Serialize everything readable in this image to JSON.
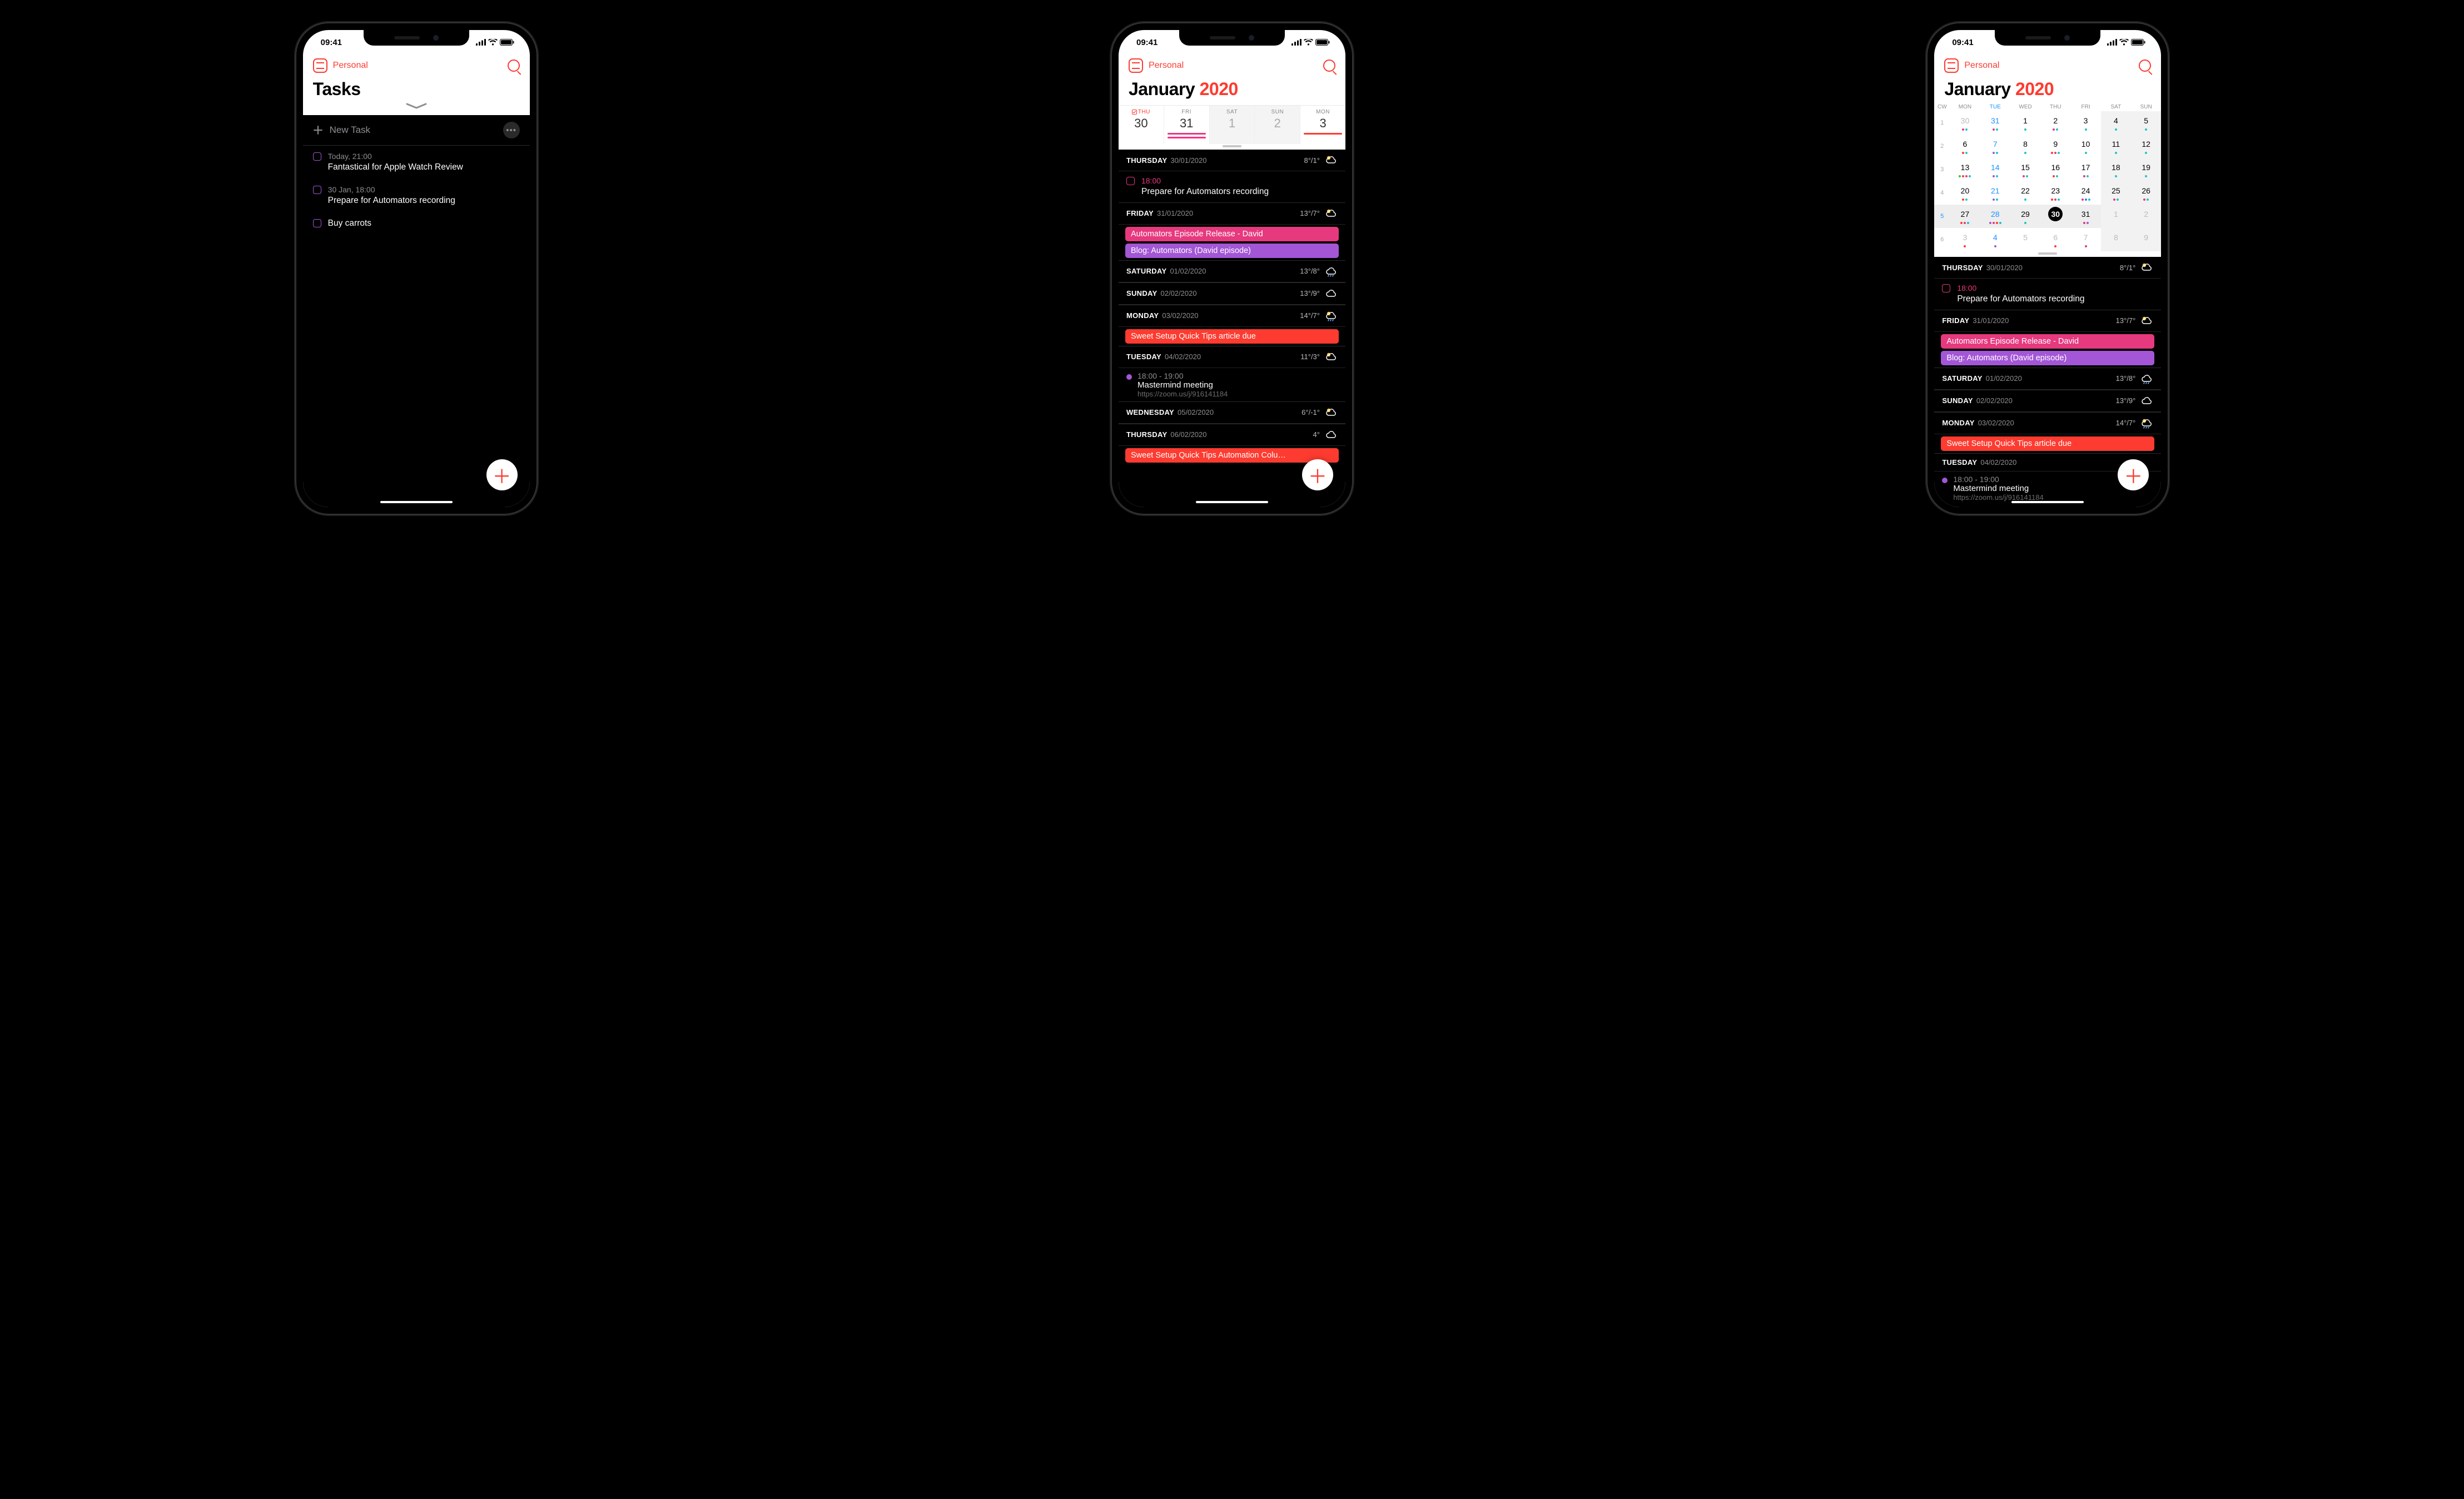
{
  "status": {
    "time": "09:41"
  },
  "header": {
    "calendar_set": "Personal"
  },
  "colors": {
    "accent": "#fd3b30",
    "pink": "#e6397e",
    "magenta": "#ff2d87",
    "purple": "#a356d6",
    "red": "#fd3b30",
    "green": "#2fc24b",
    "blue": "#2f7fff"
  },
  "phone1": {
    "title": "Tasks",
    "new_task_label": "New Task",
    "tasks": [
      {
        "time": "Today, 21:00",
        "title": "Fantastical for Apple Watch Review",
        "color": "purple"
      },
      {
        "time": "30 Jan, 18:00",
        "title": "Prepare for Automators recording",
        "color": "purple"
      },
      {
        "time": "",
        "title": "Buy carrots",
        "color": "purple"
      }
    ]
  },
  "phone2": {
    "title_month": "January",
    "title_year": "2020",
    "week": [
      {
        "label": "THU",
        "num": "30",
        "selected": true,
        "has_task": true
      },
      {
        "label": "FRI",
        "num": "31",
        "bars": [
          "#e6397e",
          "#ff2d87"
        ]
      },
      {
        "label": "SAT",
        "num": "1",
        "gray": true,
        "shade": true
      },
      {
        "label": "SUN",
        "num": "2",
        "gray": true,
        "shade": true
      },
      {
        "label": "MON",
        "num": "3",
        "bars": [
          "#fd3b30"
        ]
      }
    ],
    "agenda": [
      {
        "dow": "THURSDAY",
        "date": "30/01/2020",
        "hi": "8°",
        "lo": "1°",
        "wicon": "sun-cloud",
        "items": [
          {
            "type": "task",
            "time": "18:00",
            "title": "Prepare for Automators recording",
            "color": "pink"
          }
        ]
      },
      {
        "dow": "FRIDAY",
        "date": "31/01/2020",
        "hi": "13°",
        "lo": "7°",
        "wicon": "sun-cloud",
        "items": [
          {
            "type": "pill",
            "title": "Automators Episode Release - David",
            "bg": "#e6397e"
          },
          {
            "type": "pill",
            "title": "Blog: Automators (David episode)",
            "bg": "#a356d6"
          }
        ]
      },
      {
        "dow": "SATURDAY",
        "date": "01/02/2020",
        "hi": "13°",
        "lo": "8°",
        "wicon": "rain",
        "items": []
      },
      {
        "dow": "SUNDAY",
        "date": "02/02/2020",
        "hi": "13°",
        "lo": "9°",
        "wicon": "cloud",
        "items": []
      },
      {
        "dow": "MONDAY",
        "date": "03/02/2020",
        "hi": "14°",
        "lo": "7°",
        "wicon": "sun-rain",
        "items": [
          {
            "type": "pill",
            "title": "Sweet Setup Quick Tips article due",
            "bg": "#fd3b30"
          }
        ]
      },
      {
        "dow": "TUESDAY",
        "date": "04/02/2020",
        "hi": "11°",
        "lo": "3°",
        "wicon": "sun-cloud",
        "items": [
          {
            "type": "event",
            "time": "18:00 - 19:00",
            "title": "Mastermind meeting",
            "link": "https://zoom.us/j/916141184",
            "dot": "#a356d6"
          }
        ]
      },
      {
        "dow": "WEDNESDAY",
        "date": "05/02/2020",
        "hi": "6°",
        "lo": "-1°",
        "wicon": "sun-cloud",
        "items": []
      },
      {
        "dow": "THURSDAY",
        "date": "06/02/2020",
        "hi": "4°",
        "lo": "",
        "wicon": "cloud",
        "items": [
          {
            "type": "pill",
            "title": "Sweet Setup Quick Tips Automation Colu…",
            "bg": "#fd3b30"
          }
        ]
      }
    ]
  },
  "phone3": {
    "title_month": "January",
    "title_year": "2020",
    "month_header": [
      "CW",
      "MON",
      "TUE",
      "WED",
      "THU",
      "FRI",
      "SAT",
      "SUN"
    ],
    "weeks": [
      {
        "cw": "1",
        "days": [
          {
            "n": "30",
            "gray": true,
            "dots": [
              "pink",
              "teal"
            ]
          },
          {
            "n": "31",
            "gray": true,
            "tue": true,
            "dots": [
              "pink",
              "teal"
            ]
          },
          {
            "n": "1",
            "dots": [
              "teal"
            ]
          },
          {
            "n": "2",
            "dots": [
              "pink",
              "teal"
            ]
          },
          {
            "n": "3",
            "dots": [
              "teal"
            ]
          },
          {
            "n": "4",
            "wkend": true,
            "dots": [
              "teal"
            ]
          },
          {
            "n": "5",
            "wkend": true,
            "dots": [
              "teal"
            ]
          }
        ]
      },
      {
        "cw": "2",
        "days": [
          {
            "n": "6",
            "dots": [
              "red",
              "teal"
            ]
          },
          {
            "n": "7",
            "tue": true,
            "dots": [
              "purple",
              "teal"
            ]
          },
          {
            "n": "8",
            "dots": [
              "teal"
            ]
          },
          {
            "n": "9",
            "dots": [
              "red",
              "pink",
              "teal"
            ]
          },
          {
            "n": "10",
            "dots": [
              "teal"
            ]
          },
          {
            "n": "11",
            "wkend": true,
            "dots": [
              "teal"
            ]
          },
          {
            "n": "12",
            "wkend": true,
            "dots": [
              "teal"
            ]
          }
        ]
      },
      {
        "cw": "3",
        "days": [
          {
            "n": "13",
            "dots": [
              "green",
              "red",
              "pink",
              "teal"
            ]
          },
          {
            "n": "14",
            "tue": true,
            "dots": [
              "purple",
              "teal"
            ]
          },
          {
            "n": "15",
            "dots": [
              "pink",
              "teal"
            ]
          },
          {
            "n": "16",
            "dots": [
              "red",
              "teal"
            ]
          },
          {
            "n": "17",
            "dots": [
              "pink",
              "teal"
            ]
          },
          {
            "n": "18",
            "wkend": true,
            "dots": [
              "teal"
            ]
          },
          {
            "n": "19",
            "wkend": true,
            "dots": [
              "teal"
            ]
          }
        ]
      },
      {
        "cw": "4",
        "days": [
          {
            "n": "20",
            "dots": [
              "red",
              "teal"
            ]
          },
          {
            "n": "21",
            "tue": true,
            "dots": [
              "purple",
              "teal"
            ]
          },
          {
            "n": "22",
            "dots": [
              "teal"
            ]
          },
          {
            "n": "23",
            "dots": [
              "red",
              "pink",
              "teal"
            ]
          },
          {
            "n": "24",
            "dots": [
              "pink",
              "blue",
              "teal"
            ]
          },
          {
            "n": "25",
            "wkend": true,
            "dots": [
              "pink",
              "teal"
            ]
          },
          {
            "n": "26",
            "wkend": true,
            "dots": [
              "pink",
              "teal"
            ]
          }
        ]
      },
      {
        "cw": "5",
        "sel": true,
        "cwblue": true,
        "days": [
          {
            "n": "27",
            "dots": [
              "red",
              "pink",
              "teal"
            ]
          },
          {
            "n": "28",
            "tue": true,
            "dots": [
              "purple",
              "pink",
              "red",
              "teal"
            ]
          },
          {
            "n": "29",
            "dots": [
              "teal"
            ]
          },
          {
            "n": "30",
            "today": true,
            "dots": []
          },
          {
            "n": "31",
            "dots": [
              "pink",
              "purple"
            ]
          },
          {
            "n": "1",
            "gray": true,
            "wkend": true
          },
          {
            "n": "2",
            "gray": true,
            "wkend": true
          }
        ]
      },
      {
        "cw": "6",
        "days": [
          {
            "n": "3",
            "gray": true,
            "dots": [
              "red"
            ]
          },
          {
            "n": "4",
            "gray": true,
            "tue": true,
            "dots": [
              "purple"
            ]
          },
          {
            "n": "5",
            "gray": true
          },
          {
            "n": "6",
            "gray": true,
            "dots": [
              "red"
            ]
          },
          {
            "n": "7",
            "gray": true,
            "dots": [
              "pink"
            ]
          },
          {
            "n": "8",
            "gray": true,
            "wkend": true
          },
          {
            "n": "9",
            "gray": true,
            "wkend": true
          }
        ]
      }
    ],
    "agenda": [
      {
        "dow": "THURSDAY",
        "date": "30/01/2020",
        "hi": "8°",
        "lo": "1°",
        "wicon": "sun-cloud",
        "items": [
          {
            "type": "task",
            "time": "18:00",
            "title": "Prepare for Automators recording",
            "color": "pink"
          }
        ]
      },
      {
        "dow": "FRIDAY",
        "date": "31/01/2020",
        "hi": "13°",
        "lo": "7°",
        "wicon": "sun-cloud",
        "items": [
          {
            "type": "pill",
            "title": "Automators Episode Release - David",
            "bg": "#e6397e"
          },
          {
            "type": "pill",
            "title": "Blog: Automators (David episode)",
            "bg": "#a356d6"
          }
        ]
      },
      {
        "dow": "SATURDAY",
        "date": "01/02/2020",
        "hi": "13°",
        "lo": "8°",
        "wicon": "rain",
        "items": []
      },
      {
        "dow": "SUNDAY",
        "date": "02/02/2020",
        "hi": "13°",
        "lo": "9°",
        "wicon": "cloud",
        "items": []
      },
      {
        "dow": "MONDAY",
        "date": "03/02/2020",
        "hi": "14°",
        "lo": "7°",
        "wicon": "sun-rain",
        "items": [
          {
            "type": "pill",
            "title": "Sweet Setup Quick Tips article due",
            "bg": "#fd3b30"
          }
        ]
      },
      {
        "dow": "TUESDAY",
        "date": "04/02/2020",
        "hi": "",
        "lo": "",
        "wicon": "",
        "items": [
          {
            "type": "event",
            "time": "18:00 - 19:00",
            "title": "Mastermind meeting",
            "link": "https://zoom.us/j/916141184",
            "dot": "#a356d6"
          }
        ]
      }
    ]
  }
}
